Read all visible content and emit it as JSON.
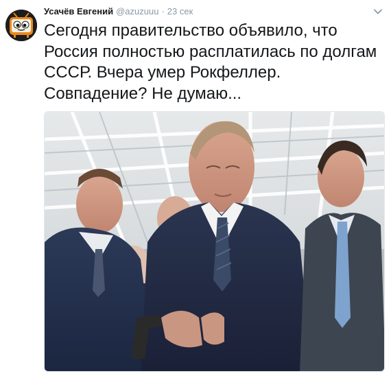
{
  "tweet": {
    "display_name": "Усачёв Евгений",
    "handle": "@azuzuuu",
    "separator": "·",
    "time": "23 сек",
    "text": "Сегодня правительство объявило, что Россия полностью расплатилась по долгам СССР. Вчера умер Рокфеллер. Совпадение? Не думаю...",
    "avatar_icon": "tv-character-icon",
    "menu_icon": "chevron-down-icon"
  },
  "colors": {
    "name": "#14171a",
    "meta": "#8899a6",
    "avatar_bg": "#1d1d1d",
    "tv_orange": "#e8891e"
  }
}
